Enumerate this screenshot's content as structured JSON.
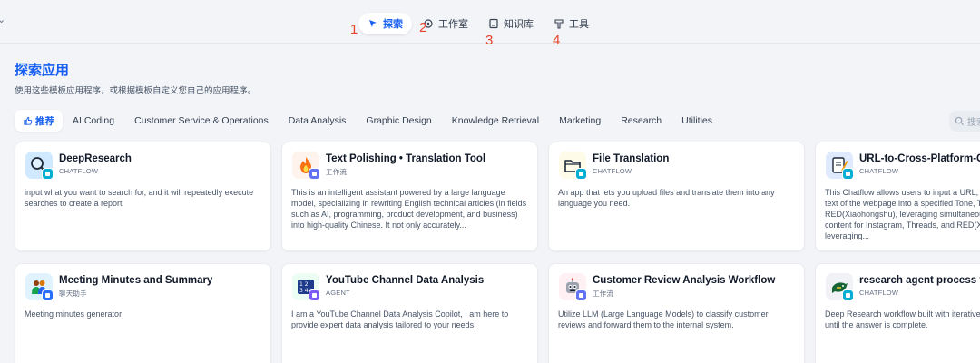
{
  "nav": {
    "items": [
      {
        "label": "探索",
        "active": true,
        "icon": "compass-icon"
      },
      {
        "label": "工作室",
        "active": false,
        "icon": "studio-icon"
      },
      {
        "label": "知识库",
        "active": false,
        "icon": "book-icon"
      },
      {
        "label": "工具",
        "active": false,
        "icon": "tool-icon"
      }
    ],
    "annotations": [
      "1",
      "2",
      "3",
      "4"
    ]
  },
  "page": {
    "title": "探索应用",
    "subtitle": "使用这些模板应用程序，或根据模板自定义您自己的应用程序。"
  },
  "tabs": [
    {
      "label": "推荐",
      "active": true
    },
    {
      "label": "AI Coding"
    },
    {
      "label": "Customer Service & Operations"
    },
    {
      "label": "Data Analysis"
    },
    {
      "label": "Graphic Design"
    },
    {
      "label": "Knowledge Retrieval"
    },
    {
      "label": "Marketing"
    },
    {
      "label": "Research"
    },
    {
      "label": "Utilities"
    }
  ],
  "search": {
    "placeholder": "搜索"
  },
  "cards": [
    {
      "name": "DeepResearch",
      "mode": "CHATFLOW",
      "icon": "magnifier-icon",
      "icon_bg": "#d1e9ff",
      "badge_color": "#06aed4",
      "description": "input what you want to search for, and it will repeatedly execute searches to create a report"
    },
    {
      "name": "Text Polishing • Translation Tool",
      "mode": "工作流",
      "icon": "flame-icon",
      "icon_bg": "#fff4ed",
      "badge_color": "#6172f3",
      "description": "This is an intelligent assistant powered by a large language model, specializing in rewriting English technical articles (in fields such as AI, programming, product development, and business) into high-quality Chinese. It not only accurately..."
    },
    {
      "name": "File Translation",
      "mode": "CHATFLOW",
      "icon": "folder-icon",
      "icon_bg": "#fefbe8",
      "badge_color": "#06aed4",
      "description": "An app that lets you upload files and translate them into any language you need."
    },
    {
      "name": "URL-to-Cross-Platform-Content",
      "mode": "CHATFLOW",
      "icon": "memo-icon",
      "icon_bg": "#e0eaff",
      "badge_color": "#06aed4",
      "description": "This Chatflow allows users to input a URL, and it will extract the text of the webpage into a specified Tone, Threads, and RED(Xiaohongshu), leveraging simultaneously outputting content for Instagram, Threads, and RED(Xiaohongshu), leveraging..."
    },
    {
      "name": "Meeting Minutes and Summary",
      "mode": "聊天助手",
      "icon": "people-icon",
      "icon_bg": "#e0f2fe",
      "badge_color": "#2970ff",
      "description": "Meeting minutes generator"
    },
    {
      "name": "YouTube Channel Data Analysis",
      "mode": "AGENT",
      "icon": "numbers-icon",
      "icon_bg": "#ecfdf3",
      "badge_color": "#7a5af8",
      "description": "I am a YouTube Channel Data Analysis Copilot, I am here to provide expert data analysis tailored to your needs."
    },
    {
      "name": "Customer Review Analysis Workflow",
      "mode": "工作流",
      "icon": "robot-icon",
      "icon_bg": "#fff1f3",
      "badge_color": "#6172f3",
      "description": "Utilize LLM (Large Language Models) to classify customer reviews and forward them to the internal system."
    },
    {
      "name": "research agent process flow",
      "mode": "CHATFLOW",
      "icon": "bird-icon",
      "icon_bg": "#f0f2f5",
      "badge_color": "#06aed4",
      "description": "Deep Research workflow built with iterative search over sources until the answer is complete."
    }
  ]
}
